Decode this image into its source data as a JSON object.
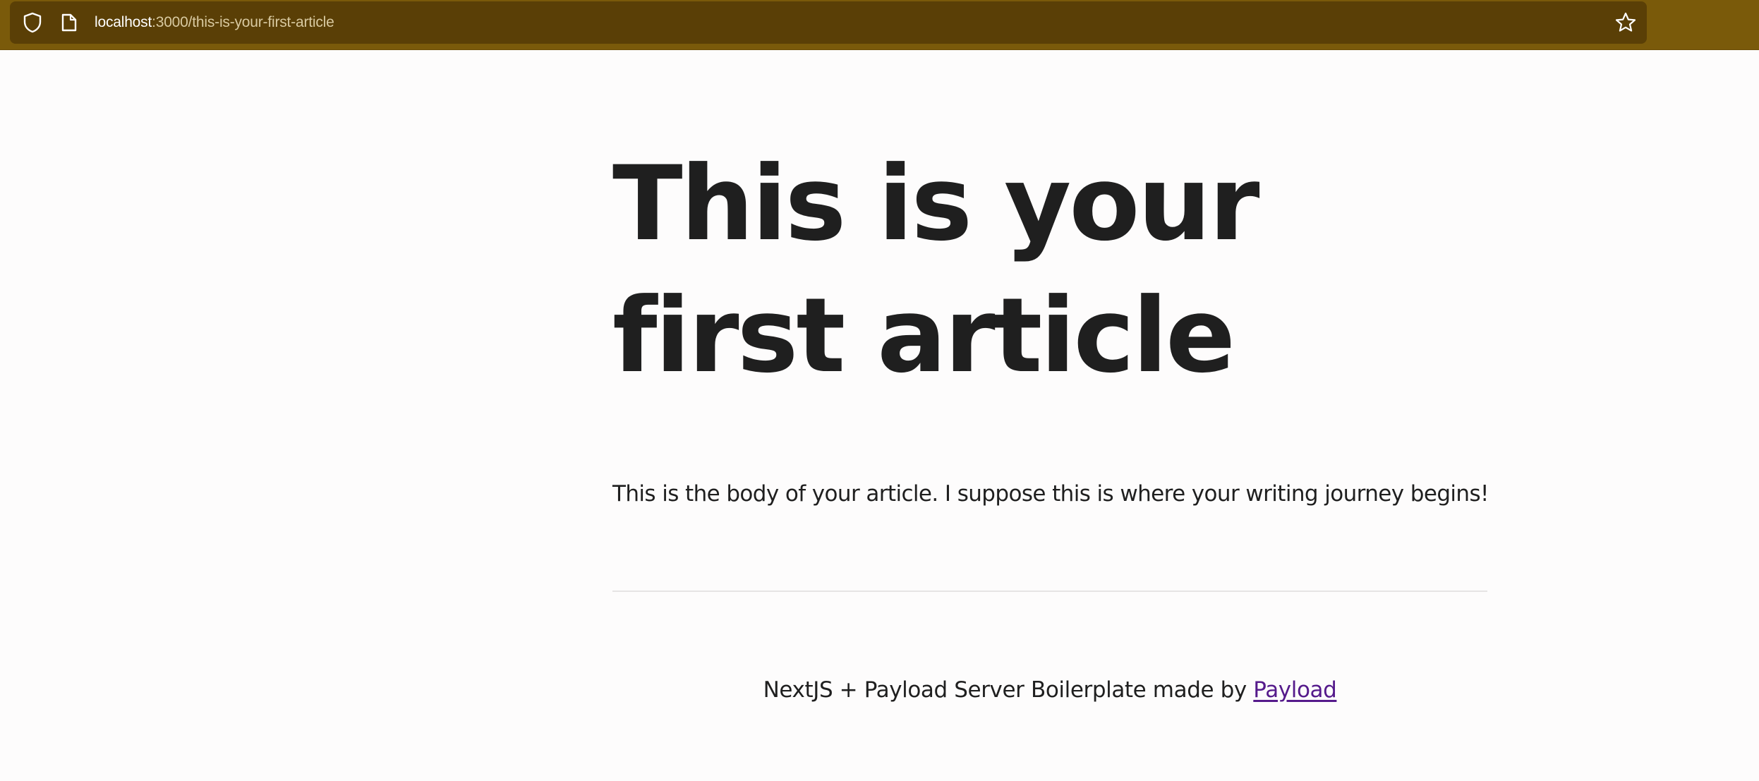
{
  "browser": {
    "url_host": "localhost",
    "url_path": ":3000/this-is-your-first-article",
    "icons": {
      "security": "shield-icon",
      "page": "page-icon",
      "bookmark": "star-icon"
    },
    "colors": {
      "toolbar": "#7a5a0a",
      "urlbar": "#5a3f06"
    }
  },
  "article": {
    "title": "This is your first article",
    "body": "This is the body of your article. I suppose this is where your writing journey begins!"
  },
  "footer": {
    "text": "NextJS + Payload Server Boilerplate made by ",
    "link_label": "Payload",
    "link_color": "#551a8b"
  }
}
